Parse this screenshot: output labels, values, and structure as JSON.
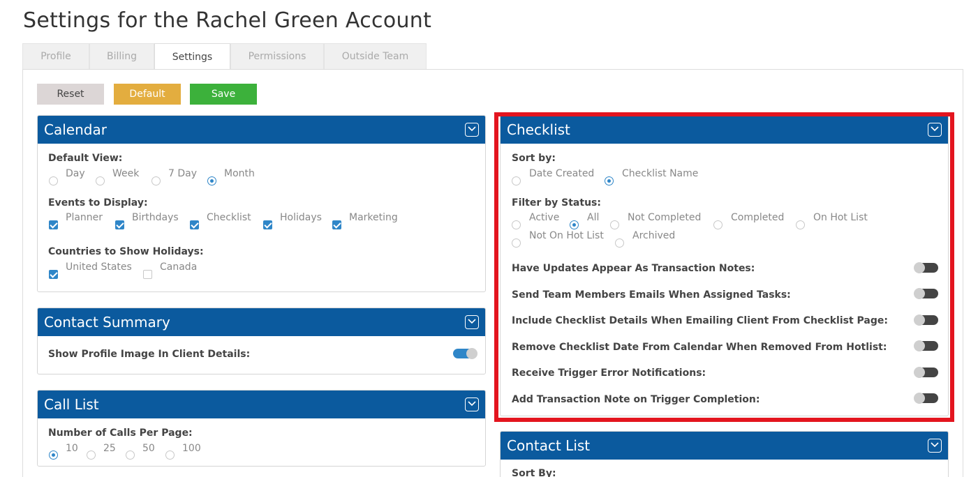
{
  "page_title": "Settings for the Rachel Green Account",
  "tabs": [
    "Profile",
    "Billing",
    "Settings",
    "Permissions",
    "Outside Team"
  ],
  "active_tab": "Settings",
  "buttons": {
    "reset": "Reset",
    "default": "Default",
    "save": "Save"
  },
  "calendar": {
    "title": "Calendar",
    "default_view": {
      "label": "Default View:",
      "options": [
        "Day",
        "Week",
        "7 Day",
        "Month"
      ],
      "selected": "Month"
    },
    "events": {
      "label": "Events to Display:",
      "options": [
        "Planner",
        "Birthdays",
        "Checklist",
        "Holidays",
        "Marketing"
      ],
      "checked": [
        true,
        true,
        true,
        true,
        true
      ]
    },
    "countries": {
      "label": "Countries to Show Holidays:",
      "options": [
        "United States",
        "Canada"
      ],
      "checked": [
        true,
        false
      ]
    }
  },
  "contact_summary": {
    "title": "Contact Summary",
    "show_profile_image_label": "Show Profile Image In Client Details:",
    "show_profile_image": true
  },
  "call_list": {
    "title": "Call List",
    "calls_per_page": {
      "label": "Number of Calls Per Page:",
      "options": [
        "10",
        "25",
        "50",
        "100"
      ],
      "selected": "10"
    }
  },
  "checklist": {
    "title": "Checklist",
    "sort_by": {
      "label": "Sort by:",
      "options": [
        "Date Created",
        "Checklist Name"
      ],
      "selected": "Checklist Name"
    },
    "filter_by_status": {
      "label": "Filter by Status:",
      "options": [
        "Active",
        "All",
        "Not Completed",
        "Completed",
        "On Hot List",
        "Not On Hot List",
        "Archived"
      ],
      "selected": "All"
    },
    "toggles": [
      {
        "label": "Have Updates Appear As Transaction Notes:",
        "on": false
      },
      {
        "label": "Send Team Members Emails When Assigned Tasks:",
        "on": false
      },
      {
        "label": "Include Checklist Details When Emailing Client From Checklist Page:",
        "on": false
      },
      {
        "label": "Remove Checklist Date From Calendar When Removed From Hotlist:",
        "on": false
      },
      {
        "label": "Receive Trigger Error Notifications:",
        "on": false
      },
      {
        "label": "Add Transaction Note on Trigger Completion:",
        "on": false
      }
    ]
  },
  "contact_list": {
    "title": "Contact List",
    "sort_by_label": "Sort By:"
  },
  "colors": {
    "header_blue": "#0b5a9e",
    "highlight_red": "#e3151f",
    "save_green": "#3cb13b",
    "default_gold": "#e3ad3f",
    "reset_gray": "#dcd6d6",
    "accent_blue": "#2f86c8"
  }
}
